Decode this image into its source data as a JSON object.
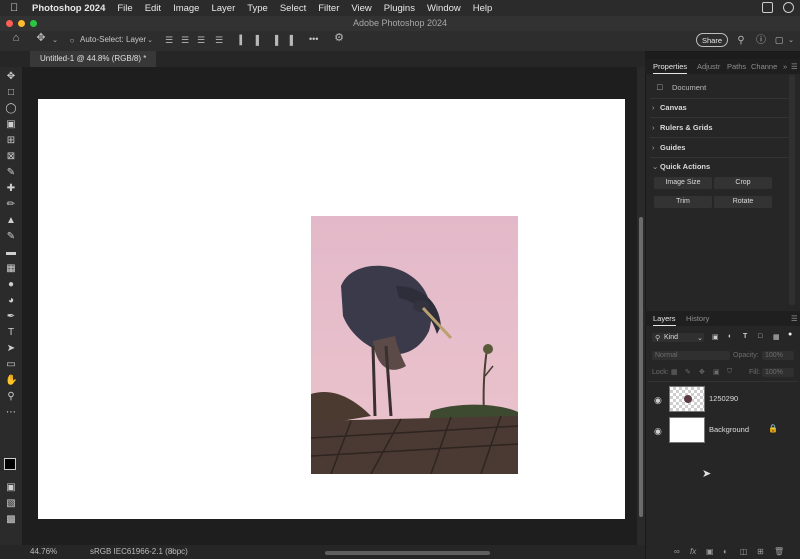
{
  "menubar": {
    "app_name": "Photoshop 2024",
    "items": [
      "File",
      "Edit",
      "Image",
      "Layer",
      "Type",
      "Select",
      "Filter",
      "View",
      "Plugins",
      "Window",
      "Help"
    ]
  },
  "window": {
    "title": "Adobe Photoshop 2024"
  },
  "options_bar": {
    "auto_select_label": "Auto-Select:",
    "auto_select_value": "Layer",
    "more": "•••",
    "share_label": "Share"
  },
  "document": {
    "tab_title": "Untitled-1 @ 44.8% (RGB/8) *"
  },
  "status": {
    "zoom": "44.76%",
    "profile": "sRGB IEC61966-2.1 (8bpc)",
    "arrow": "›"
  },
  "properties_panel": {
    "tabs": [
      "Properties",
      "Adjustr",
      "Paths",
      "Channe"
    ],
    "doc_label": "Document",
    "sections": [
      "Canvas",
      "Rulers & Grids",
      "Guides",
      "Quick Actions"
    ],
    "quick_actions": [
      "Image Size",
      "Crop",
      "Trim",
      "Rotate"
    ]
  },
  "layers_panel": {
    "tabs": [
      "Layers",
      "History"
    ],
    "filter_value": "Kind",
    "blend_mode": "Normal",
    "opacity_label": "Opacity:",
    "opacity_value": "100%",
    "lock_label": "Lock:",
    "fill_label": "Fill:",
    "fill_value": "100%",
    "layers": [
      {
        "name": "1250290"
      },
      {
        "name": "Background"
      }
    ]
  },
  "colors": {
    "menubar": "#2b2b2b",
    "panel_bg": "#262626",
    "canvas": "#ffffff",
    "photo_sky": "#e7bccb",
    "traffic_red": "#fe5f57",
    "traffic_yellow": "#febc2e",
    "traffic_green": "#28c840"
  }
}
